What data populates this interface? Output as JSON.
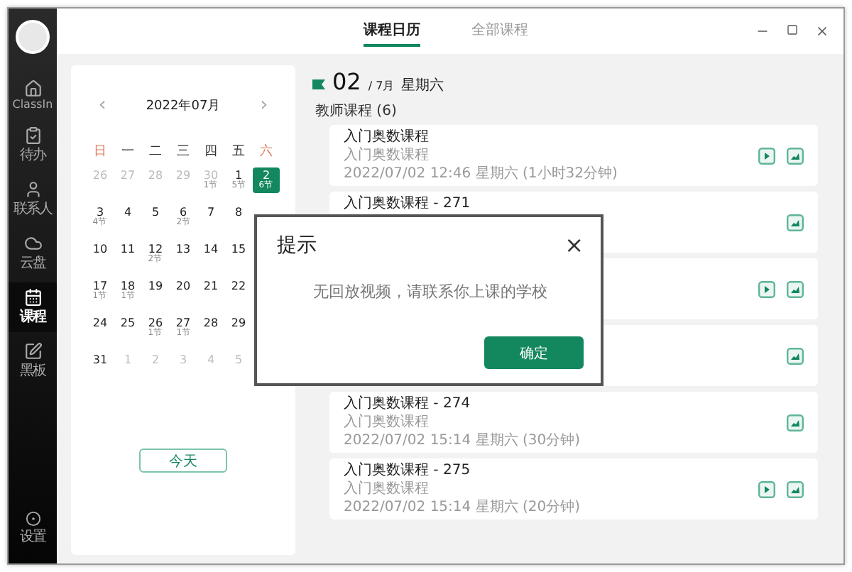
{
  "sidebar": {
    "items": [
      {
        "label": "ClassIn",
        "selected": false
      },
      {
        "label": "待办",
        "selected": false
      },
      {
        "label": "联系人",
        "selected": false
      },
      {
        "label": "云盘",
        "selected": false
      },
      {
        "label": "课程",
        "selected": true
      },
      {
        "label": "黑板",
        "selected": false
      }
    ],
    "bottom": {
      "label": "设置"
    }
  },
  "tabs": [
    {
      "label": "课程日历",
      "selected": true
    },
    {
      "label": "全部课程",
      "selected": false
    }
  ],
  "calendar": {
    "month": "2022年07月",
    "prev": "‹",
    "next": "›",
    "weekdays": [
      {
        "label": "日",
        "weekend": true
      },
      {
        "label": "一",
        "weekend": false
      },
      {
        "label": "二",
        "weekend": false
      },
      {
        "label": "三",
        "weekend": false
      },
      {
        "label": "四",
        "weekend": false
      },
      {
        "label": "五",
        "weekend": false
      },
      {
        "label": "六",
        "weekend": true
      }
    ],
    "weeks": [
      [
        {
          "day": "26",
          "muted": true,
          "selected": false
        },
        {
          "day": "27",
          "muted": true,
          "selected": false
        },
        {
          "day": "28",
          "muted": true,
          "selected": false
        },
        {
          "day": "29",
          "muted": true,
          "selected": false
        },
        {
          "day": "30",
          "muted": true,
          "selected": false,
          "sessions": "1节"
        },
        {
          "day": "1",
          "muted": false,
          "selected": false,
          "sessions": "5节"
        },
        {
          "day": "2",
          "muted": false,
          "selected": true,
          "sessions": "6节"
        }
      ],
      [
        {
          "day": "3",
          "muted": false,
          "selected": false,
          "sessions": "4节"
        },
        {
          "day": "4",
          "muted": false,
          "selected": false
        },
        {
          "day": "5",
          "muted": false,
          "selected": false
        },
        {
          "day": "6",
          "muted": false,
          "selected": false,
          "sessions": "2节"
        },
        {
          "day": "7",
          "muted": false,
          "selected": false
        },
        {
          "day": "8",
          "muted": false,
          "selected": false
        }
      ],
      [
        {
          "day": "10",
          "muted": false,
          "selected": false
        },
        {
          "day": "11",
          "muted": false,
          "selected": false
        },
        {
          "day": "12",
          "muted": false,
          "selected": false,
          "sessions": "2节"
        },
        {
          "day": "13",
          "muted": false,
          "selected": false
        },
        {
          "day": "14",
          "muted": false,
          "selected": false
        },
        {
          "day": "15",
          "muted": false,
          "selected": false
        }
      ],
      [
        {
          "day": "17",
          "muted": false,
          "selected": false,
          "sessions": "1节"
        },
        {
          "day": "18",
          "muted": false,
          "selected": false,
          "sessions": "1节"
        },
        {
          "day": "19",
          "muted": false,
          "selected": false
        },
        {
          "day": "20",
          "muted": false,
          "selected": false
        },
        {
          "day": "21",
          "muted": false,
          "selected": false
        },
        {
          "day": "22",
          "muted": false,
          "selected": false
        }
      ],
      [
        {
          "day": "24",
          "muted": false,
          "selected": false
        },
        {
          "day": "25",
          "muted": false,
          "selected": false
        },
        {
          "day": "26",
          "muted": false,
          "selected": false,
          "sessions": "1节"
        },
        {
          "day": "27",
          "muted": false,
          "selected": false,
          "sessions": "1节"
        },
        {
          "day": "28",
          "muted": false,
          "selected": false
        },
        {
          "day": "29",
          "muted": false,
          "selected": false
        }
      ],
      [
        {
          "day": "31",
          "muted": false,
          "selected": false
        },
        {
          "day": "1",
          "muted": true,
          "selected": false
        },
        {
          "day": "2",
          "muted": true,
          "selected": false
        },
        {
          "day": "3",
          "muted": true,
          "selected": false
        },
        {
          "day": "4",
          "muted": true,
          "selected": false
        },
        {
          "day": "5",
          "muted": true,
          "selected": false
        }
      ]
    ],
    "today_button": "今天"
  },
  "day_header": {
    "day": "02",
    "month": "/ 7月",
    "weekday": "星期六"
  },
  "section": "教师课程 (6)",
  "courses": [
    {
      "title": "入门奥数课程",
      "subtitle": "入门奥数课程",
      "time": "2022/07/02 12:46 星期六 (1小时32分钟)",
      "playback": true
    },
    {
      "title": "入门奥数课程 - 271",
      "playback": false
    },
    {
      "playback": true
    },
    {
      "playback": false
    },
    {
      "title": "入门奥数课程 - 274",
      "subtitle": "入门奥数课程",
      "time": "2022/07/02 15:14 星期六 (30分钟)",
      "playback": false
    },
    {
      "title": "入门奥数课程 - 275",
      "subtitle": "入门奥数课程",
      "time": "2022/07/02 15:14 星期六 (20分钟)",
      "playback": true
    }
  ],
  "dialog": {
    "title": "提示",
    "close": "×",
    "message": "无回放视频，请联系你上课的学校",
    "button": "确定"
  }
}
